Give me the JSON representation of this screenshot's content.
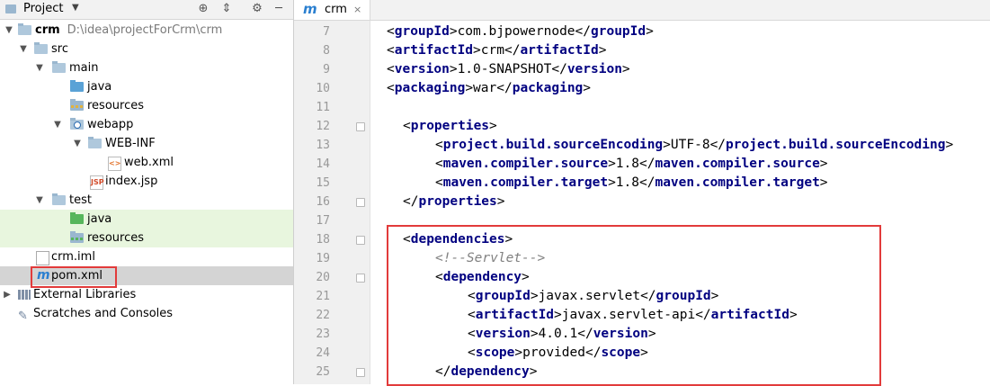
{
  "project_panel": {
    "title": "Project",
    "tree": [
      {
        "label": "crm",
        "sub": "D:\\idea\\projectForCrm\\crm",
        "bold": true
      },
      {
        "label": "src"
      },
      {
        "label": "main"
      },
      {
        "label": "java"
      },
      {
        "label": "resources"
      },
      {
        "label": "webapp"
      },
      {
        "label": "WEB-INF"
      },
      {
        "label": "web.xml"
      },
      {
        "label": "index.jsp"
      },
      {
        "label": "test"
      },
      {
        "label": "java"
      },
      {
        "label": "resources"
      },
      {
        "label": "crm.iml"
      },
      {
        "label": "pom.xml"
      },
      {
        "label": "External Libraries"
      },
      {
        "label": "Scratches and Consoles"
      }
    ]
  },
  "editor": {
    "tab": {
      "icon_text": "m",
      "label": "crm",
      "close": "×"
    },
    "lines": [
      {
        "num": "7",
        "pre": "",
        "tag1": "groupId",
        "text": "com.bjpowernode",
        "tag2": "groupId"
      },
      {
        "num": "8",
        "pre": "",
        "tag1": "artifactId",
        "text": "crm",
        "tag2": "artifactId"
      },
      {
        "num": "9",
        "pre": "",
        "tag1": "version",
        "text": "1.0-SNAPSHOT",
        "tag2": "version"
      },
      {
        "num": "10",
        "pre": "",
        "tag1": "packaging",
        "text": "war",
        "tag2": "packaging"
      },
      {
        "num": "11"
      },
      {
        "num": "12",
        "open": "properties"
      },
      {
        "num": "13",
        "tag1": "project.build.sourceEncoding",
        "text": "UTF-8",
        "tag2": "project.build.sourceEncoding"
      },
      {
        "num": "14",
        "tag1": "maven.compiler.source",
        "text": "1.8",
        "tag2": "maven.compiler.source"
      },
      {
        "num": "15",
        "tag1": "maven.compiler.target",
        "text": "1.8",
        "tag2": "maven.compiler.target"
      },
      {
        "num": "16",
        "close": "properties"
      },
      {
        "num": "17"
      },
      {
        "num": "18",
        "open": "dependencies"
      },
      {
        "num": "19",
        "comment": "<!--Servlet-->"
      },
      {
        "num": "20",
        "open": "dependency"
      },
      {
        "num": "21",
        "tag1": "groupId",
        "text": "javax.servlet",
        "tag2": "groupId"
      },
      {
        "num": "22",
        "tag1": "artifactId",
        "text": "javax.servlet-api",
        "tag2": "artifactId"
      },
      {
        "num": "23",
        "tag1": "version",
        "text": "4.0.1",
        "tag2": "version"
      },
      {
        "num": "24",
        "tag1": "scope",
        "text": "provided",
        "tag2": "scope"
      },
      {
        "num": "25",
        "close": "dependency"
      }
    ]
  }
}
